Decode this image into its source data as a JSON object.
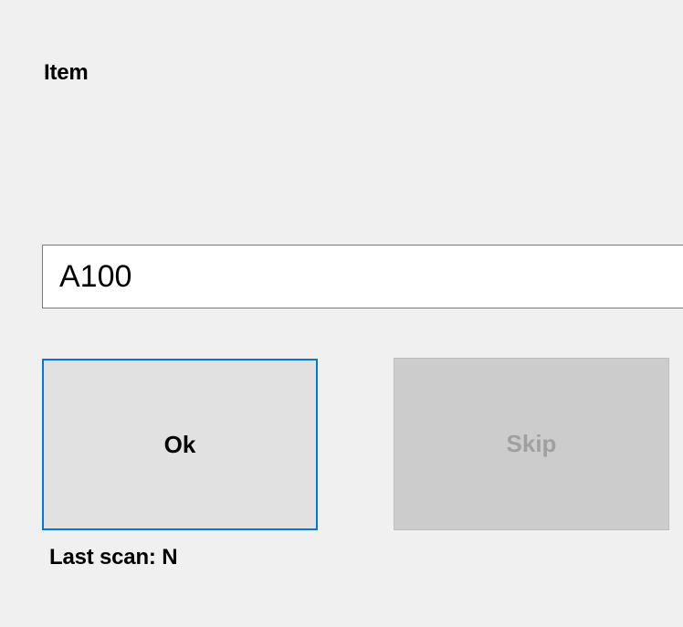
{
  "form": {
    "item_label": "Item",
    "item_value": "A100"
  },
  "buttons": {
    "ok_label": "Ok",
    "skip_label": "Skip"
  },
  "status": {
    "last_scan_label": "Last scan:",
    "last_scan_value": "N"
  }
}
